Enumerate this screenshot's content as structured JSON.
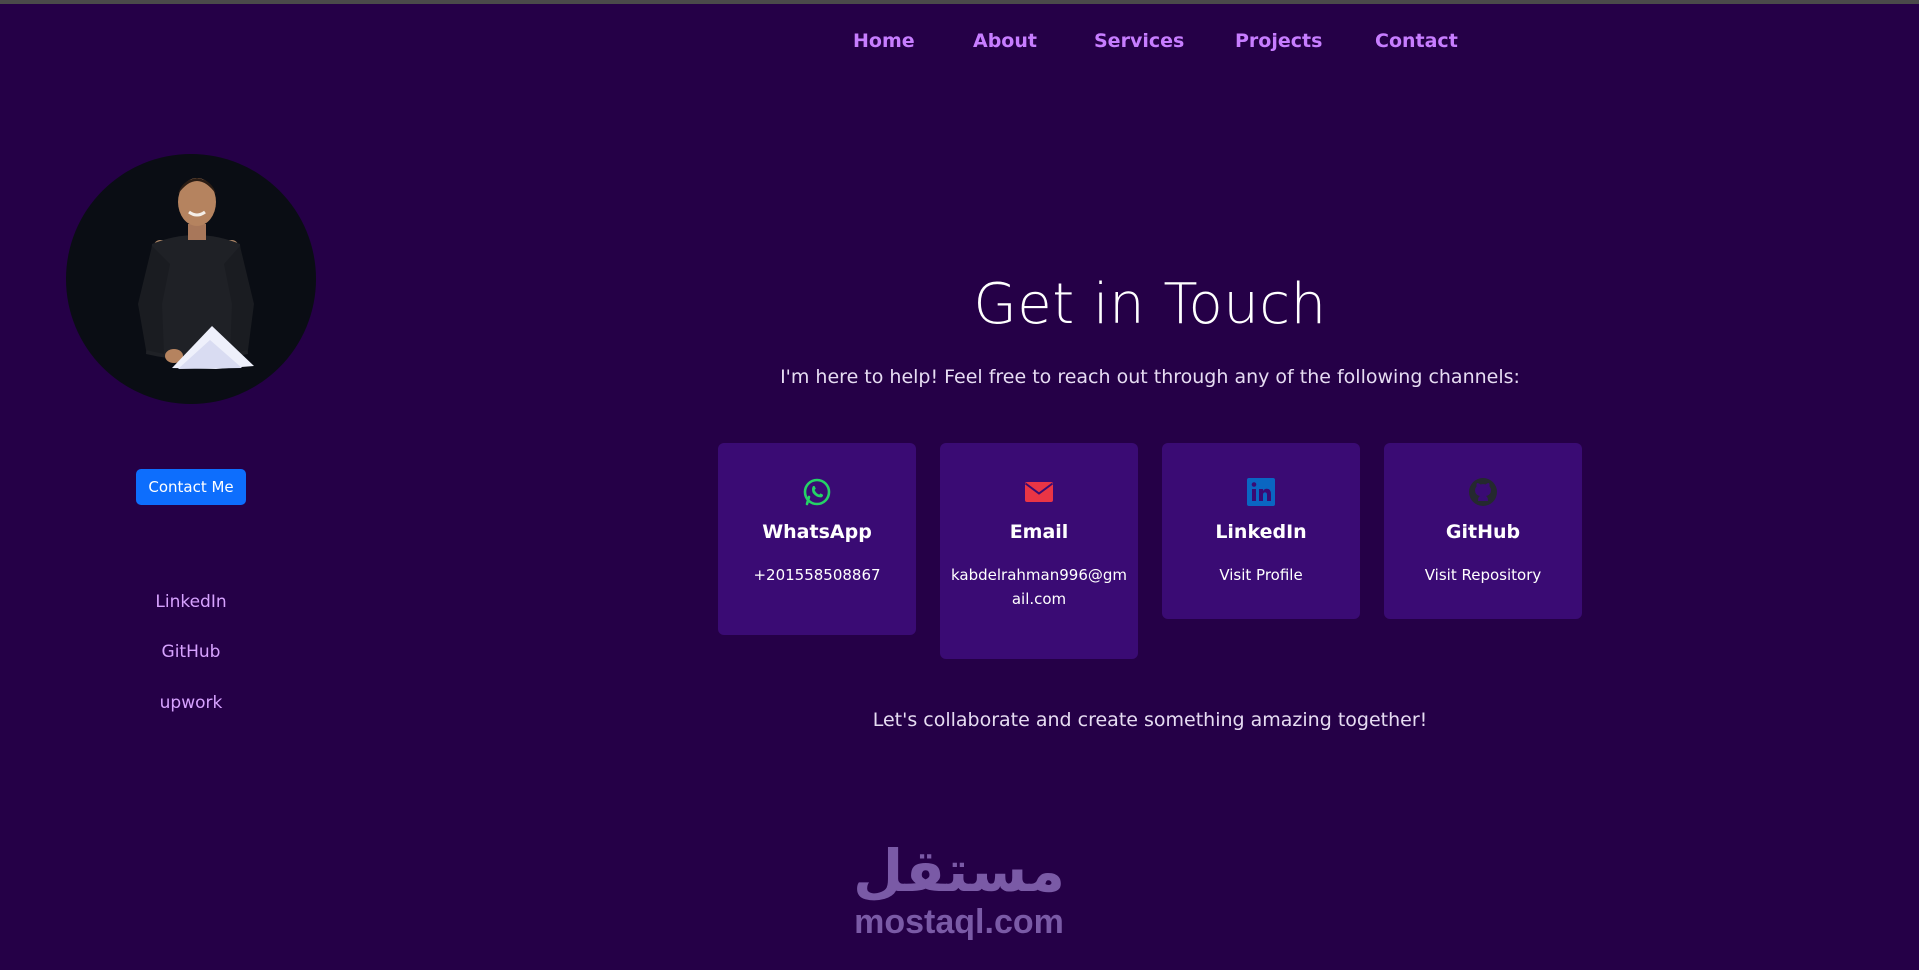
{
  "nav": {
    "items": [
      {
        "label": "Home"
      },
      {
        "label": "About"
      },
      {
        "label": "Services"
      },
      {
        "label": "Projects"
      },
      {
        "label": "Contact"
      }
    ]
  },
  "sidebar": {
    "contact_button": "Contact Me",
    "links": [
      {
        "label": "LinkedIn"
      },
      {
        "label": "GitHub"
      },
      {
        "label": "upwork"
      }
    ]
  },
  "main": {
    "title": "Get in Touch",
    "subtitle": "I'm here to help! Feel free to reach out through any of the following channels:",
    "cards": [
      {
        "title": "WhatsApp",
        "value": "+201558508867",
        "icon": "whatsapp-icon",
        "color": "#25d366"
      },
      {
        "title": "Email",
        "value": "kabdelrahman996@gmail.com",
        "icon": "envelope-icon",
        "color": "#ea3545"
      },
      {
        "title": "LinkedIn",
        "value": "Visit Profile",
        "icon": "linkedin-icon",
        "color": "#0a66c2"
      },
      {
        "title": "GitHub",
        "value": "Visit Repository",
        "icon": "github-icon",
        "color": "#24292e"
      }
    ],
    "closing": "Let's collaborate and create something amazing together!"
  },
  "watermark": {
    "arabic": "مستقل",
    "latin": "mostaql.com"
  },
  "colors": {
    "background": "#250047",
    "accent": "#c77dff",
    "card": "#3a0b74",
    "button": "#0d6efd"
  }
}
